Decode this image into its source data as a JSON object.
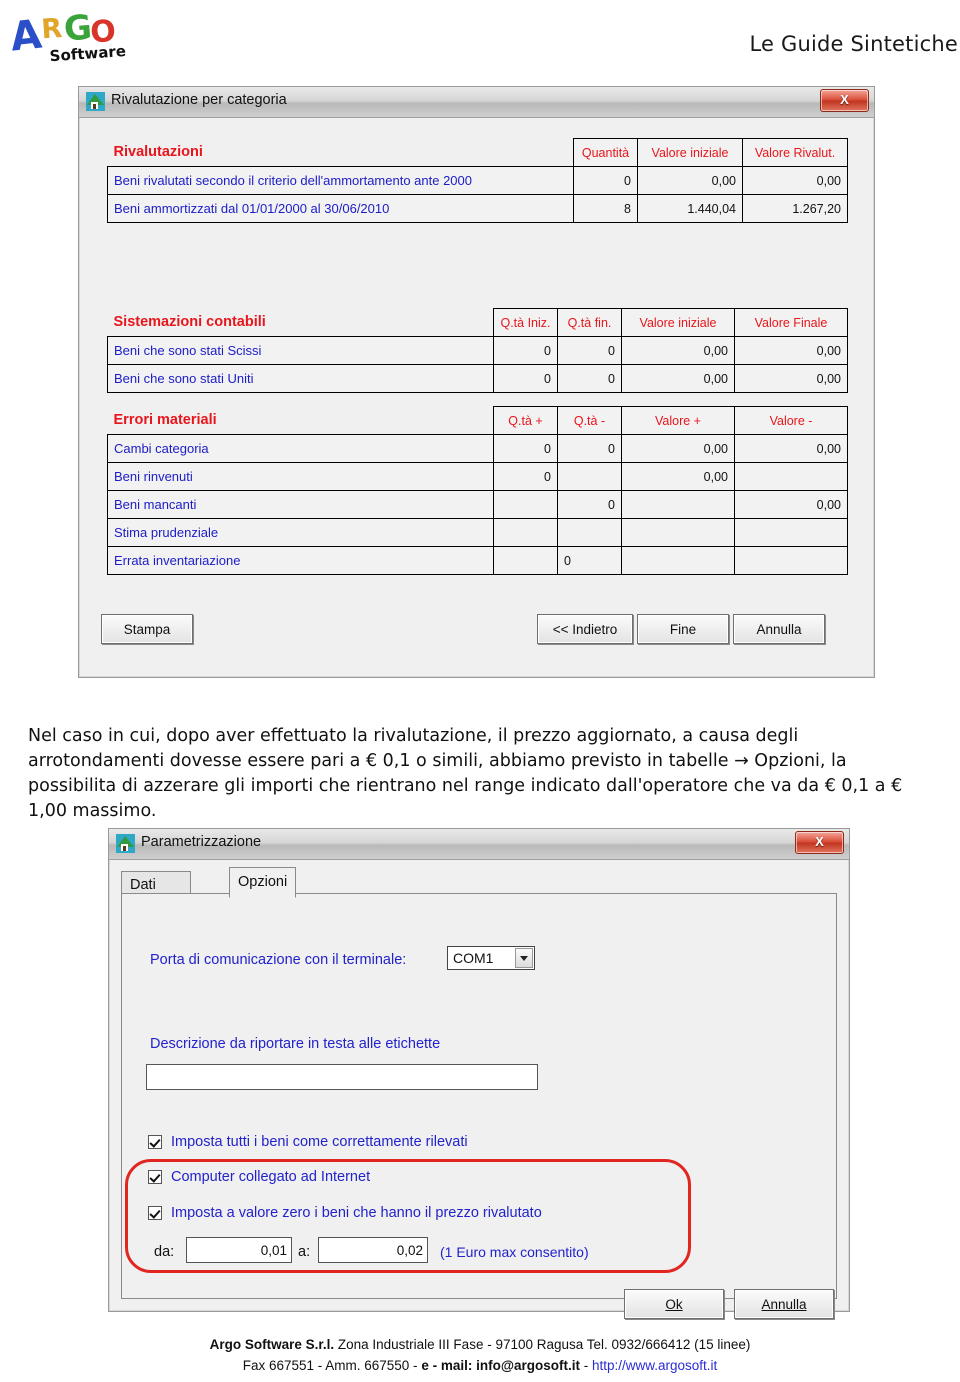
{
  "header": {
    "logo_letters": [
      {
        "char": "A",
        "color": "#2b4fc8"
      },
      {
        "char": "R",
        "color": "#e0a52a"
      },
      {
        "char": "G",
        "color": "#3aa33a"
      },
      {
        "char": "O",
        "color": "#d8342a"
      }
    ],
    "logo_sub": "Software",
    "guide_title": "Le Guide Sintetiche"
  },
  "dialog1": {
    "title": "Rivalutazione per categoria",
    "close_label": "X",
    "icon": "app-house-icon",
    "table1": {
      "section_label": "Rivalutazioni",
      "columns": [
        "Quantità",
        "Valore iniziale",
        "Valore Rivalut."
      ],
      "rows": [
        {
          "name": "Beni rivalutati secondo il criterio dell'ammortamento ante 2000",
          "cells": [
            "0",
            "0,00",
            "0,00"
          ]
        },
        {
          "name": "Beni ammortizzati dal 01/01/2000 al 30/06/2010",
          "cells": [
            "8",
            "1.440,04",
            "1.267,20"
          ]
        }
      ]
    },
    "table2": {
      "section_label": "Sistemazioni contabili",
      "columns": [
        "Q.tà Iniz.",
        "Q.tà fin.",
        "Valore iniziale",
        "Valore Finale"
      ],
      "rows": [
        {
          "name": "Beni che sono stati Scissi",
          "cells": [
            "0",
            "0",
            "0,00",
            "0,00"
          ]
        },
        {
          "name": "Beni che sono stati Uniti",
          "cells": [
            "0",
            "0",
            "0,00",
            "0,00"
          ]
        }
      ]
    },
    "table3": {
      "section_label": "Errori materiali",
      "columns": [
        "Q.tà +",
        "Q.tà -",
        "Valore +",
        "Valore -"
      ],
      "rows": [
        {
          "name": "Cambi categoria",
          "cells": [
            "0",
            "0",
            "0,00",
            "0,00"
          ],
          "types": [
            "num",
            "num",
            "num",
            "num"
          ]
        },
        {
          "name": "Beni rinvenuti",
          "cells": [
            "0",
            "",
            "0,00",
            ""
          ],
          "types": [
            "num",
            "hatch",
            "num",
            "hatch"
          ]
        },
        {
          "name": "Beni mancanti",
          "cells": [
            "",
            "0",
            "",
            "0,00"
          ],
          "types": [
            "hatch",
            "num",
            "hatch",
            "num"
          ]
        },
        {
          "name": "Stima prudenziale",
          "cells": [
            "",
            "",
            "",
            ""
          ],
          "types": [
            "blank",
            "blank",
            "blank",
            "blank"
          ]
        },
        {
          "name": "Errata inventariazione",
          "cells": [
            "",
            "0",
            "",
            ""
          ],
          "types": [
            "blank",
            "numl",
            "blank",
            "blank"
          ]
        }
      ]
    },
    "buttons": {
      "print": "Stampa",
      "back": "<< Indietro",
      "finish": "Fine",
      "cancel": "Annulla"
    }
  },
  "paragraph": "Nel caso in cui, dopo aver effettuato la rivalutazione, il prezzo aggiornato, a causa degli arrotondamenti dovesse essere pari a € 0,1 o simili, abbiamo previsto in tabelle → Opzioni, la possibilita di azzerare gli importi che rientrano nel range indicato dall'operatore che va da € 0,1 a € 1,00 massimo.",
  "dialog2": {
    "title": "Parametrizzazione",
    "close_label": "X",
    "icon": "app-house-icon",
    "tabs": [
      {
        "label": "Dati generali",
        "active": false
      },
      {
        "label": "Opzioni",
        "active": true
      }
    ],
    "port_label": "Porta di comunicazione con il terminale:",
    "port_value": "COM1",
    "description_label": "Descrizione da riportare in testa alle etichette",
    "description_value": "",
    "checkboxes": [
      {
        "label": "Imposta tutti i beni come correttamente rilevati",
        "checked": true
      },
      {
        "label": "Computer collegato ad Internet",
        "checked": true
      },
      {
        "label": "Imposta a valore zero i beni che hanno il prezzo rivalutato",
        "checked": true
      }
    ],
    "range": {
      "from_label": "da:",
      "from_value": "0,01",
      "to_label": "a:",
      "to_value": "0,02",
      "hint": "(1 Euro max consentito)"
    },
    "buttons": {
      "ok": "Ok",
      "cancel": "Annulla"
    }
  },
  "footer": {
    "company": "Argo Software S.r.l.",
    "address": " Zona Industriale III Fase - 97100 Ragusa Tel. 0932/666412 (15 linee)",
    "line2_prefix": "Fax 667551 - Amm. 667550 - ",
    "email_label": "e - mail: info@argosoft.it",
    "dash": " - ",
    "url": "http://www.argosoft.it"
  }
}
